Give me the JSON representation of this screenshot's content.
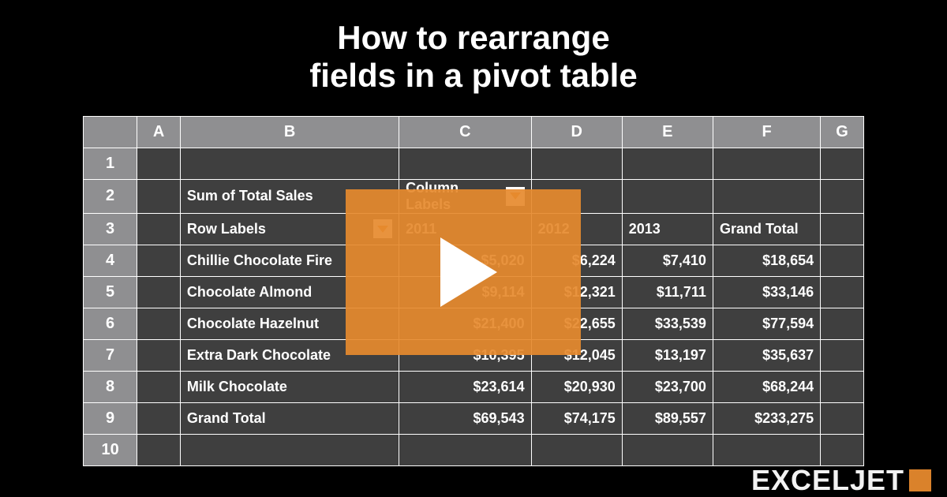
{
  "title_line1": "How to rearrange",
  "title_line2": "fields in a pivot table",
  "columns": {
    "A": "A",
    "B": "B",
    "C": "C",
    "D": "D",
    "E": "E",
    "F": "F",
    "G": "G"
  },
  "rows": {
    "r1": "1",
    "r2": "2",
    "r3": "3",
    "r4": "4",
    "r5": "5",
    "r6": "6",
    "r7": "7",
    "r8": "8",
    "r9": "9",
    "r10": "10"
  },
  "pivot": {
    "header_b": "Sum of Total Sales",
    "header_c": "Column Labels",
    "row_labels": "Row Labels",
    "years": {
      "y1": "2011",
      "y2": "2012",
      "y3": "2013"
    },
    "grand_total_label": "Grand Total",
    "data": [
      {
        "name": "Chillie Chocolate Fire",
        "c": "$5,020",
        "d": "$6,224",
        "e": "$7,410",
        "f": "$18,654"
      },
      {
        "name": "Chocolate Almond",
        "c": "$9,114",
        "d": "$12,321",
        "e": "$11,711",
        "f": "$33,146"
      },
      {
        "name": "Chocolate Hazelnut",
        "c": "$21,400",
        "d": "$22,655",
        "e": "$33,539",
        "f": "$77,594"
      },
      {
        "name": "Extra Dark Chocolate",
        "c": "$10,395",
        "d": "$12,045",
        "e": "$13,197",
        "f": "$35,637"
      },
      {
        "name": "Milk Chocolate",
        "c": "$23,614",
        "d": "$20,930",
        "e": "$23,700",
        "f": "$68,244"
      }
    ],
    "totals": {
      "name": "Grand Total",
      "c": "$69,543",
      "d": "$74,175",
      "e": "$89,557",
      "f": "$233,275"
    }
  },
  "brand": "EXCELJET",
  "chart_data": {
    "type": "table",
    "title": "Sum of Total Sales",
    "columns": [
      "2011",
      "2012",
      "2013",
      "Grand Total"
    ],
    "rows": [
      "Chillie Chocolate Fire",
      "Chocolate Almond",
      "Chocolate Hazelnut",
      "Extra Dark Chocolate",
      "Milk Chocolate",
      "Grand Total"
    ],
    "values": [
      [
        5020,
        6224,
        7410,
        18654
      ],
      [
        9114,
        12321,
        11711,
        33146
      ],
      [
        21400,
        22655,
        33539,
        77594
      ],
      [
        10395,
        12045,
        13197,
        35637
      ],
      [
        23614,
        20930,
        23700,
        68244
      ],
      [
        69543,
        74175,
        89557,
        233275
      ]
    ]
  }
}
